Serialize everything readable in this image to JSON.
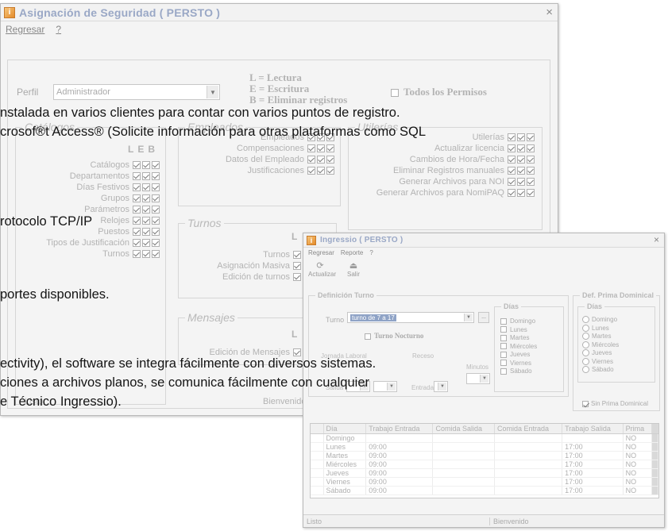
{
  "main_window": {
    "title": "Asignación de Seguridad   ( PERSTO )",
    "app_icon": "app-icon",
    "close_glyph": "×",
    "menu": [
      "Regresar",
      "?"
    ],
    "perfil_label": "Perfil",
    "perfil_value": "Administrador",
    "legend": [
      "L = Lectura",
      "E = Escritura",
      "B = Eliminar registros"
    ],
    "todos_label": "Todos  los Permisos",
    "catalogos": {
      "title": "Catálogos",
      "headers": [
        "L",
        "E",
        "B"
      ],
      "items": [
        "Catálogos",
        "Departamentos",
        "Días Festivos",
        "Grupos",
        "Parámetros",
        "Relojes",
        "Puestos",
        "Tipos de Justificación",
        "Turnos"
      ]
    },
    "empleados": {
      "title": "Empleados",
      "items": [
        "Empleados",
        "Compensaciones",
        "Datos del Empleado",
        "Justificaciones"
      ]
    },
    "utilerias": {
      "title": "Utilerías",
      "items": [
        "Utilerías",
        "Actualizar licencia",
        "Cambios de Hora/Fecha",
        "Eliminar Registros manuales",
        "Generar Archivos para NOI",
        "Generar Archivos para NomiPAQ"
      ]
    },
    "turnos": {
      "title": "Turnos",
      "header": "L",
      "items": [
        "Turnos",
        "Asignación Masiva",
        "Edición de turnos"
      ]
    },
    "mensajes": {
      "title": "Mensajes",
      "header": "L",
      "items": [
        "Edición de Mensajes"
      ]
    },
    "status": [
      "Listo",
      "Bienvenido"
    ]
  },
  "second_window": {
    "title": "Ingressio   ( PERSTO )",
    "menu": [
      "Regresar",
      "Reporte",
      "?"
    ],
    "toolbar": [
      {
        "label": "Actualizar",
        "icon": "refresh-icon"
      },
      {
        "label": "Salir",
        "icon": "exit-icon"
      }
    ],
    "definicion_title": "Definición Turno",
    "turno_label": "Turno",
    "turno_value": "turno de 7 a 17",
    "turno_nocturno_label": "Turno Nocturno",
    "jornada_label": "Jornada Laboral",
    "receso_label": "Receso",
    "entrada_label": "Entrada",
    "salida_label": "Salida",
    "minutos_label": "Minutos",
    "dias_title": "Días",
    "dias": [
      "Domingo",
      "Lunes",
      "Martes",
      "Miércoles",
      "Jueves",
      "Viernes",
      "Sábado"
    ],
    "prima_title": "Def. Prima Dominical",
    "prima_dias_title": "Días",
    "sin_prima_label": "Sin Prima Dominical",
    "grid": {
      "headers": [
        "Día",
        "Trabajo Entrada",
        "Comida Salida",
        "Comida Entrada",
        "Trabajo Salida",
        "Prima"
      ],
      "rows": [
        [
          "Domingo",
          "",
          "",
          "",
          "",
          "NO"
        ],
        [
          "Lunes",
          "09:00",
          "",
          "",
          "17:00",
          "NO"
        ],
        [
          "Martes",
          "09:00",
          "",
          "",
          "17:00",
          "NO"
        ],
        [
          "Miércoles",
          "09:00",
          "",
          "",
          "17:00",
          "NO"
        ],
        [
          "Jueves",
          "09:00",
          "",
          "",
          "17:00",
          "NO"
        ],
        [
          "Viernes",
          "09:00",
          "",
          "",
          "17:00",
          "NO"
        ],
        [
          "Sábado",
          "09:00",
          "",
          "",
          "17:00",
          "NO"
        ]
      ]
    },
    "status": [
      "Listo",
      "Bienvenido"
    ]
  },
  "overlay_text": [
    "nstalada en varios clientes para contar con varios puntos de registro.",
    "crosof®t Access® (Solicite información para otras plataformas como SQL",
    "rotocolo TCP/IP",
    "portes disponibles.",
    "ectivity), el software se integra fácilmente con diversos  sistemas.",
    "ciones a archivos planos, se comunica fácilmente con cualquier",
    "e Técnico Ingressio)."
  ]
}
